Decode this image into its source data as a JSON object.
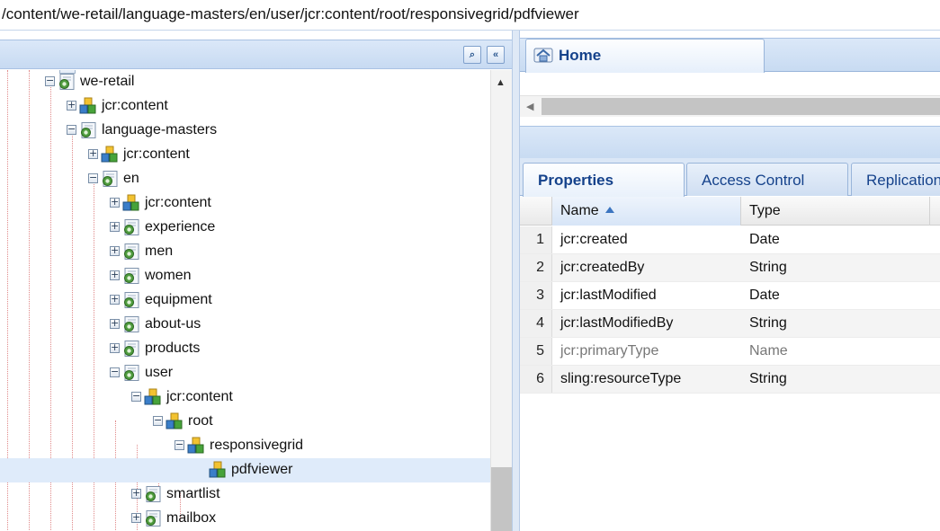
{
  "path_bar": {
    "path": "/content/we-retail/language-masters/en/user/jcr:content/root/responsivegrid/pdfviewer"
  },
  "left_header": {
    "find_glyph": "⌕",
    "collapse_glyph": "«"
  },
  "tree": [
    {
      "label": "we-retail",
      "type": "folder",
      "expanded": true
    },
    {
      "label": "jcr:content",
      "type": "content",
      "expanded": false
    },
    {
      "label": "language-masters",
      "type": "folder",
      "expanded": true
    },
    {
      "label": "jcr:content",
      "type": "content",
      "expanded": false
    },
    {
      "label": "en",
      "type": "folder",
      "expanded": true
    },
    {
      "label": "jcr:content",
      "type": "content",
      "expanded": false
    },
    {
      "label": "experience",
      "type": "folder",
      "expanded": false
    },
    {
      "label": "men",
      "type": "folder",
      "expanded": false
    },
    {
      "label": "women",
      "type": "folder",
      "expanded": false
    },
    {
      "label": "equipment",
      "type": "folder",
      "expanded": false
    },
    {
      "label": "about-us",
      "type": "folder",
      "expanded": false
    },
    {
      "label": "products",
      "type": "folder",
      "expanded": false
    },
    {
      "label": "user",
      "type": "folder",
      "expanded": true
    },
    {
      "label": "jcr:content",
      "type": "content",
      "expanded": true
    },
    {
      "label": "root",
      "type": "content",
      "expanded": true
    },
    {
      "label": "responsivegrid",
      "type": "content",
      "expanded": true
    },
    {
      "label": "pdfviewer",
      "type": "content",
      "selected": true
    },
    {
      "label": "smartlist",
      "type": "folder",
      "expanded": false
    },
    {
      "label": "mailbox",
      "type": "folder",
      "expanded": false
    }
  ],
  "home_tab": {
    "label": "Home"
  },
  "property_tabs": {
    "properties": "Properties",
    "access_control": "Access Control",
    "replication": "Replication"
  },
  "grid": {
    "columns": {
      "name": "Name",
      "type": "Type"
    },
    "rows": [
      {
        "num": "1",
        "name": "jcr:created",
        "type": "Date"
      },
      {
        "num": "2",
        "name": "jcr:createdBy",
        "type": "String"
      },
      {
        "num": "3",
        "name": "jcr:lastModified",
        "type": "Date"
      },
      {
        "num": "4",
        "name": "jcr:lastModifiedBy",
        "type": "String"
      },
      {
        "num": "5",
        "name": "jcr:primaryType",
        "type": "Name",
        "dim": true
      },
      {
        "num": "6",
        "name": "sling:resourceType",
        "type": "String"
      }
    ]
  },
  "colors": {
    "header_blue": "#c7daf2",
    "tab_text": "#15428b",
    "selection": "#dfebfa",
    "tree_guides": "#e08a8a"
  },
  "icons": {
    "folder_node": "page-node-icon",
    "content_node": "component-cube-icon",
    "home": "home-icon"
  }
}
